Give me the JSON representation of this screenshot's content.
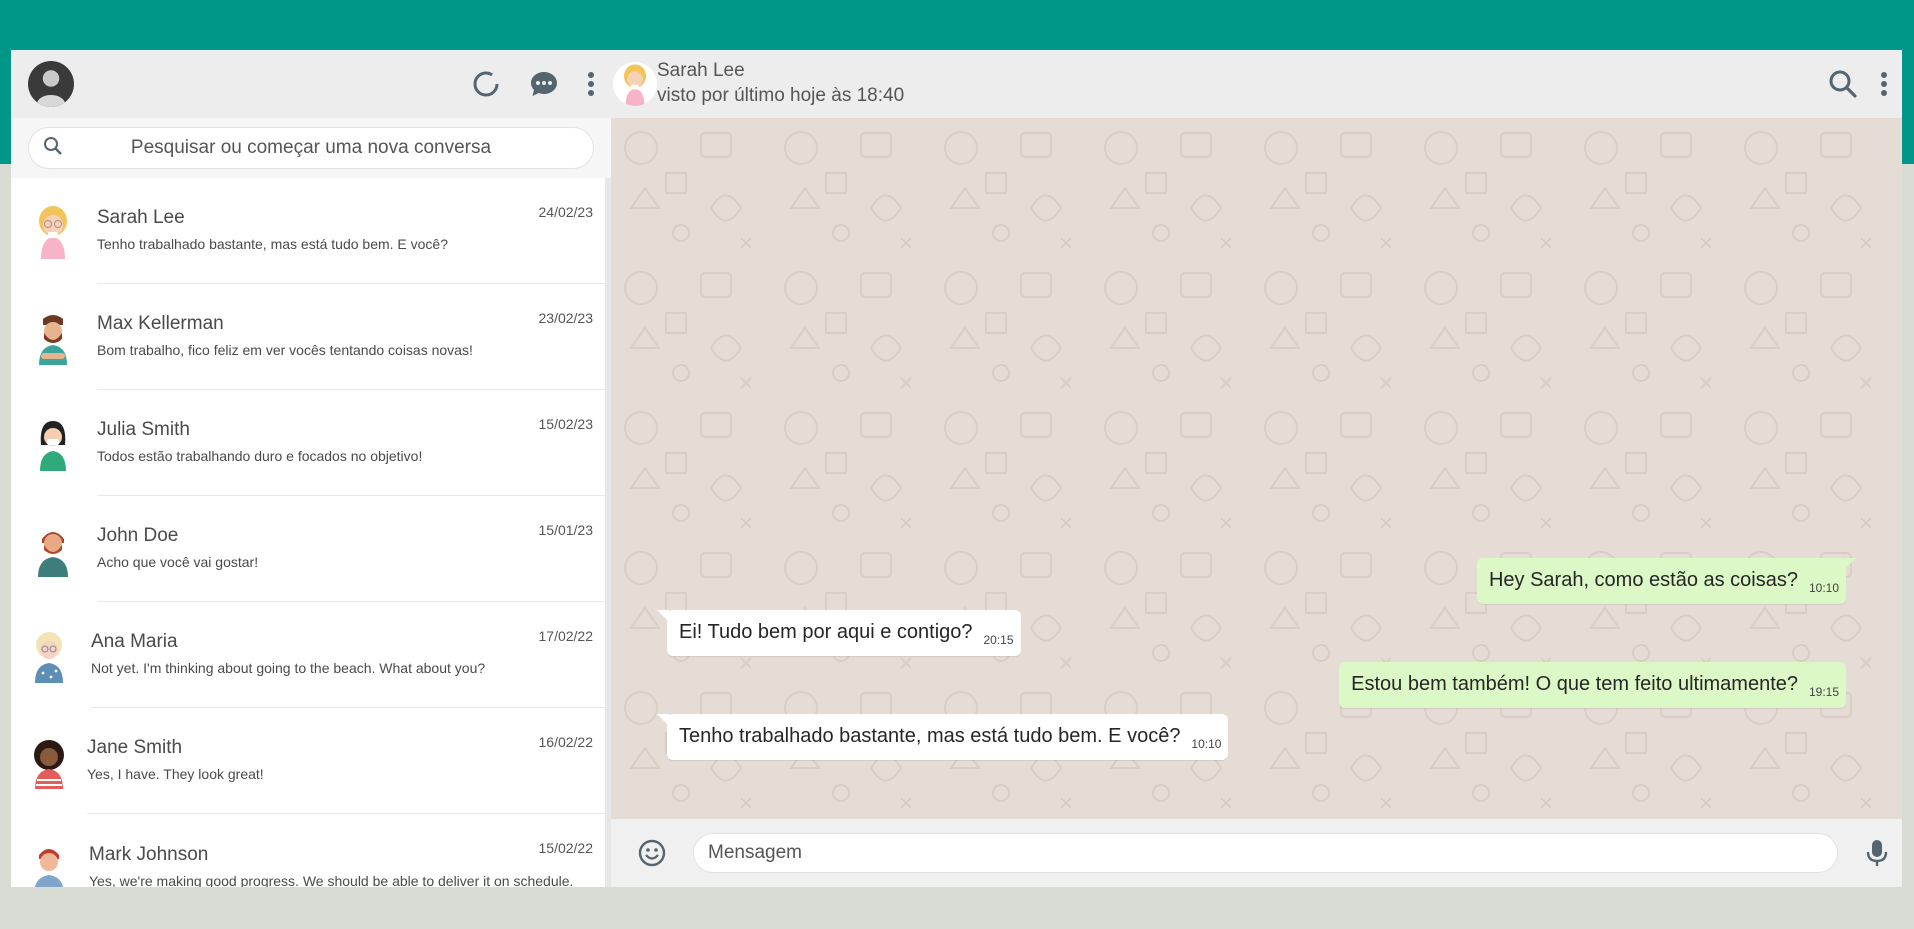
{
  "colors": {
    "brand": "#009688",
    "outgoing": "#dcf8c6",
    "incoming": "#ffffff",
    "chat_bg": "#e5ddd5"
  },
  "sidebar": {
    "header": {
      "icons": [
        "status-icon",
        "new-chat-icon",
        "menu-icon"
      ]
    },
    "search": {
      "placeholder": "Pesquisar ou começar uma nova conversa"
    },
    "chats": [
      {
        "name": "Sarah Lee",
        "date": "24/02/23",
        "preview": "Tenho trabalhado bastante, mas está tudo bem. E você?"
      },
      {
        "name": "Max Kellerman",
        "date": "23/02/23",
        "preview": "Bom trabalho, fico feliz em ver vocês tentando coisas novas!"
      },
      {
        "name": "Julia Smith",
        "date": "15/02/23",
        "preview": "Todos estão trabalhando duro e focados no objetivo!"
      },
      {
        "name": "John Doe",
        "date": "15/01/23",
        "preview": "Acho que você vai gostar!"
      },
      {
        "name": "Ana Maria",
        "date": "17/02/22",
        "preview": "Not yet. I'm thinking about going to the beach. What about you?"
      },
      {
        "name": "Jane Smith",
        "date": "16/02/22",
        "preview": "Yes, I have. They look great!"
      },
      {
        "name": "Mark Johnson",
        "date": "15/02/22",
        "preview": "Yes, we're making good progress. We should be able to deliver it on schedule."
      }
    ]
  },
  "conversation": {
    "contact_name": "Sarah Lee",
    "status": "visto por último hoje às 18:40",
    "icons": [
      "search-icon",
      "menu-icon"
    ],
    "messages": [
      {
        "direction": "out",
        "text": "Hey Sarah, como estão as coisas?",
        "time": "10:10"
      },
      {
        "direction": "in",
        "text": "Ei! Tudo bem por aqui e contigo?",
        "time": "20:15"
      },
      {
        "direction": "out",
        "text": "Estou bem também! O que tem feito ultimamente?",
        "time": "19:15"
      },
      {
        "direction": "in",
        "text": "Tenho trabalhado bastante, mas está tudo bem. E você?",
        "time": "10:10"
      }
    ],
    "composer": {
      "placeholder": "Mensagem",
      "icons": [
        "emoji-icon",
        "microphone-icon"
      ]
    }
  }
}
